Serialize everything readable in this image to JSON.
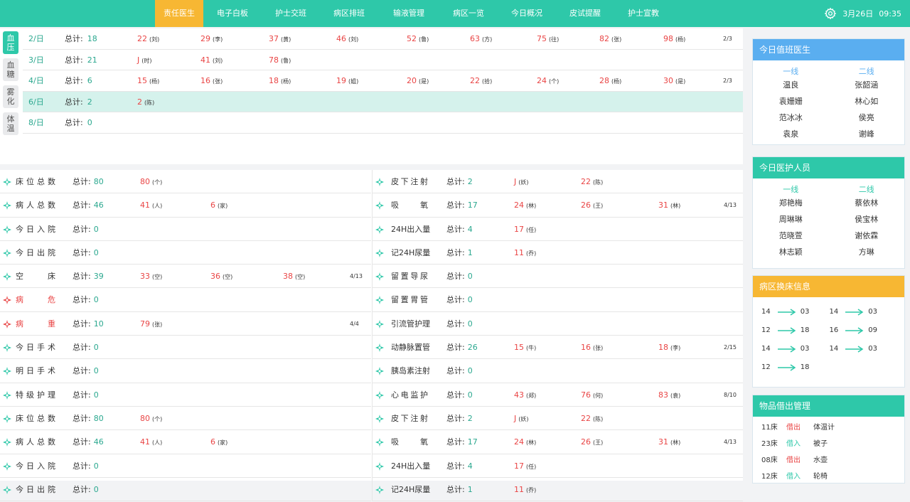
{
  "colors": {
    "teal": "#2ec8a9",
    "orange": "#f7b733",
    "blue": "#5aaef0",
    "red": "#e94545"
  },
  "nav": {
    "items": [
      "责任医生",
      "电子白板",
      "护士交班",
      "病区排班",
      "输液管理",
      "病区一览",
      "今日概况",
      "皮试提醒",
      "护士宣教"
    ],
    "active_index": 0,
    "settings_icon": "gear-icon",
    "date": "3月26日",
    "time": "09:35"
  },
  "side_tabs": [
    "血压",
    "血糖",
    "雾化",
    "体温"
  ],
  "total_label": "总计:",
  "vitals": [
    {
      "day": "2/日",
      "total": "18",
      "entries": [
        {
          "n": "22",
          "s": "(刘)"
        },
        {
          "n": "29",
          "s": "(李)"
        },
        {
          "n": "37",
          "s": "(黄)"
        },
        {
          "n": "46",
          "s": "(刘)"
        },
        {
          "n": "52",
          "s": "(鲁)"
        },
        {
          "n": "63",
          "s": "(方)"
        },
        {
          "n": "75",
          "s": "(往)"
        },
        {
          "n": "82",
          "s": "(张)"
        },
        {
          "n": "98",
          "s": "(杨)"
        }
      ],
      "page": "2/3"
    },
    {
      "day": "3/日",
      "total": "21",
      "entries": [
        {
          "n": "J",
          "s": "(时)"
        },
        {
          "n": "41",
          "s": "(刘)"
        },
        {
          "n": "78",
          "s": "(鲁)"
        }
      ],
      "page": ""
    },
    {
      "day": "4/日",
      "total": "6",
      "entries": [
        {
          "n": "15",
          "s": "(杨)"
        },
        {
          "n": "16",
          "s": "(张)"
        },
        {
          "n": "18",
          "s": "(杨)"
        },
        {
          "n": "19",
          "s": "(姐)"
        },
        {
          "n": "20",
          "s": "(是)"
        },
        {
          "n": "22",
          "s": "(拾)"
        },
        {
          "n": "24",
          "s": "(个)"
        },
        {
          "n": "28",
          "s": "(杨)"
        },
        {
          "n": "30",
          "s": "(是)"
        }
      ],
      "page": "2/3"
    },
    {
      "day": "6/日",
      "total": "2",
      "entries": [
        {
          "n": "2",
          "s": "(陈)"
        }
      ],
      "page": ""
    },
    {
      "day": "8/日",
      "total": "0",
      "entries": [],
      "page": ""
    }
  ],
  "left_list": [
    {
      "label": "床位总数",
      "alert": false,
      "total": "80",
      "entries": [
        {
          "n": "80",
          "s": "(个)"
        }
      ],
      "page": ""
    },
    {
      "label": "病人总数",
      "alert": false,
      "total": "46",
      "entries": [
        {
          "n": "41",
          "s": "(人)"
        },
        {
          "n": "6",
          "s": "(家)"
        }
      ],
      "page": ""
    },
    {
      "label": "今日入院",
      "alert": false,
      "total": "0",
      "entries": [],
      "page": ""
    },
    {
      "label": "今日出院",
      "alert": false,
      "total": "0",
      "entries": [],
      "page": ""
    },
    {
      "label": "空床",
      "alert": false,
      "total": "39",
      "entries": [
        {
          "n": "33",
          "s": "(空)"
        },
        {
          "n": "36",
          "s": "(空)"
        },
        {
          "n": "38",
          "s": "(空)"
        }
      ],
      "page": "4/13"
    },
    {
      "label": "病危",
      "alert": true,
      "total": "0",
      "entries": [],
      "page": ""
    },
    {
      "label": "病重",
      "alert": true,
      "total": "10",
      "entries": [
        {
          "n": "79",
          "s": "(张)"
        }
      ],
      "page": "4/4"
    },
    {
      "label": "今日手术",
      "alert": false,
      "total": "0",
      "entries": [],
      "page": ""
    },
    {
      "label": "明日手术",
      "alert": false,
      "total": "0",
      "entries": [],
      "page": ""
    },
    {
      "label": "特级护理",
      "alert": false,
      "total": "0",
      "entries": [],
      "page": ""
    },
    {
      "label": "床位总数",
      "alert": false,
      "total": "80",
      "entries": [
        {
          "n": "80",
          "s": "(个)"
        }
      ],
      "page": ""
    },
    {
      "label": "病人总数",
      "alert": false,
      "total": "46",
      "entries": [
        {
          "n": "41",
          "s": "(人)"
        },
        {
          "n": "6",
          "s": "(家)"
        }
      ],
      "page": ""
    },
    {
      "label": "今日入院",
      "alert": false,
      "total": "0",
      "entries": [],
      "page": ""
    },
    {
      "label": "今日出院",
      "alert": false,
      "total": "0",
      "entries": [],
      "page": ""
    }
  ],
  "right_list": [
    {
      "label": "皮下注射",
      "alert": false,
      "total": "2",
      "entries": [
        {
          "n": "J",
          "s": "(妖)"
        },
        {
          "n": "22",
          "s": "(陈)"
        }
      ],
      "page": ""
    },
    {
      "label": "吸氧",
      "alert": false,
      "total": "17",
      "entries": [
        {
          "n": "24",
          "s": "(林)"
        },
        {
          "n": "26",
          "s": "(王)"
        },
        {
          "n": "31",
          "s": "(林)"
        }
      ],
      "page": "4/13"
    },
    {
      "label": "24H出入量",
      "alert": false,
      "total": "4",
      "entries": [
        {
          "n": "17",
          "s": "(任)"
        }
      ],
      "page": ""
    },
    {
      "label": "记24H尿量",
      "alert": false,
      "total": "1",
      "entries": [
        {
          "n": "11",
          "s": "(乔)"
        }
      ],
      "page": ""
    },
    {
      "label": "留置导尿",
      "alert": false,
      "total": "0",
      "entries": [],
      "page": ""
    },
    {
      "label": "留置胃管",
      "alert": false,
      "total": "0",
      "entries": [],
      "page": ""
    },
    {
      "label": "引流管护理",
      "alert": false,
      "total": "0",
      "entries": [],
      "page": ""
    },
    {
      "label": "动静脉置管",
      "alert": false,
      "total": "26",
      "entries": [
        {
          "n": "15",
          "s": "(牛)"
        },
        {
          "n": "16",
          "s": "(张)"
        },
        {
          "n": "18",
          "s": "(李)"
        }
      ],
      "page": "2/15"
    },
    {
      "label": "胰岛素注射",
      "alert": false,
      "total": "0",
      "entries": [],
      "page": ""
    },
    {
      "label": "心电监护",
      "alert": false,
      "total": "0",
      "entries": [
        {
          "n": "43",
          "s": "(郑)"
        },
        {
          "n": "76",
          "s": "(何)"
        },
        {
          "n": "83",
          "s": "(袁)"
        }
      ],
      "page": "8/10"
    },
    {
      "label": "皮下注射",
      "alert": false,
      "total": "2",
      "entries": [
        {
          "n": "J",
          "s": "(妖)"
        },
        {
          "n": "22",
          "s": "(陈)"
        }
      ],
      "page": ""
    },
    {
      "label": "吸氧",
      "alert": false,
      "total": "17",
      "entries": [
        {
          "n": "24",
          "s": "(林)"
        },
        {
          "n": "26",
          "s": "(王)"
        },
        {
          "n": "31",
          "s": "(林)"
        }
      ],
      "page": "4/13"
    },
    {
      "label": "24H出入量",
      "alert": false,
      "total": "4",
      "entries": [
        {
          "n": "17",
          "s": "(任)"
        }
      ],
      "page": ""
    },
    {
      "label": "记24H尿量",
      "alert": false,
      "total": "1",
      "entries": [
        {
          "n": "11",
          "s": "(乔)"
        }
      ],
      "page": ""
    }
  ],
  "duty_doctors": {
    "title": "今日值班医生",
    "col1_header": "一线",
    "col2_header": "二线",
    "rows": [
      [
        "温良",
        "张韶涵"
      ],
      [
        "袁姗姗",
        "林心如"
      ],
      [
        "范冰冰",
        "侯亮"
      ],
      [
        "袁泉",
        "谢峰"
      ]
    ]
  },
  "duty_staff": {
    "title": "今日医护人员",
    "col1_header": "一线",
    "col2_header": "二线",
    "rows": [
      [
        "郑艳梅",
        "蔡依林"
      ],
      [
        "周琳琳",
        "侯宝林"
      ],
      [
        "范晓萱",
        "谢依霖"
      ],
      [
        "林志颖",
        "方琳"
      ]
    ]
  },
  "bed_swap": {
    "title": "病区换床信息",
    "pairs": [
      [
        "14",
        "03"
      ],
      [
        "14",
        "03"
      ],
      [
        "12",
        "18"
      ],
      [
        "16",
        "09"
      ],
      [
        "14",
        "03"
      ],
      [
        "14",
        "03"
      ],
      [
        "12",
        "18"
      ]
    ]
  },
  "items_loan": {
    "title": "物品借出管理",
    "rows": [
      {
        "bed": "11床",
        "type": "借出",
        "out": true,
        "item": "体温计"
      },
      {
        "bed": "23床",
        "type": "借入",
        "out": false,
        "item": "被子"
      },
      {
        "bed": "08床",
        "type": "借出",
        "out": true,
        "item": "水壶"
      },
      {
        "bed": "12床",
        "type": "借入",
        "out": false,
        "item": "轮椅"
      }
    ]
  }
}
